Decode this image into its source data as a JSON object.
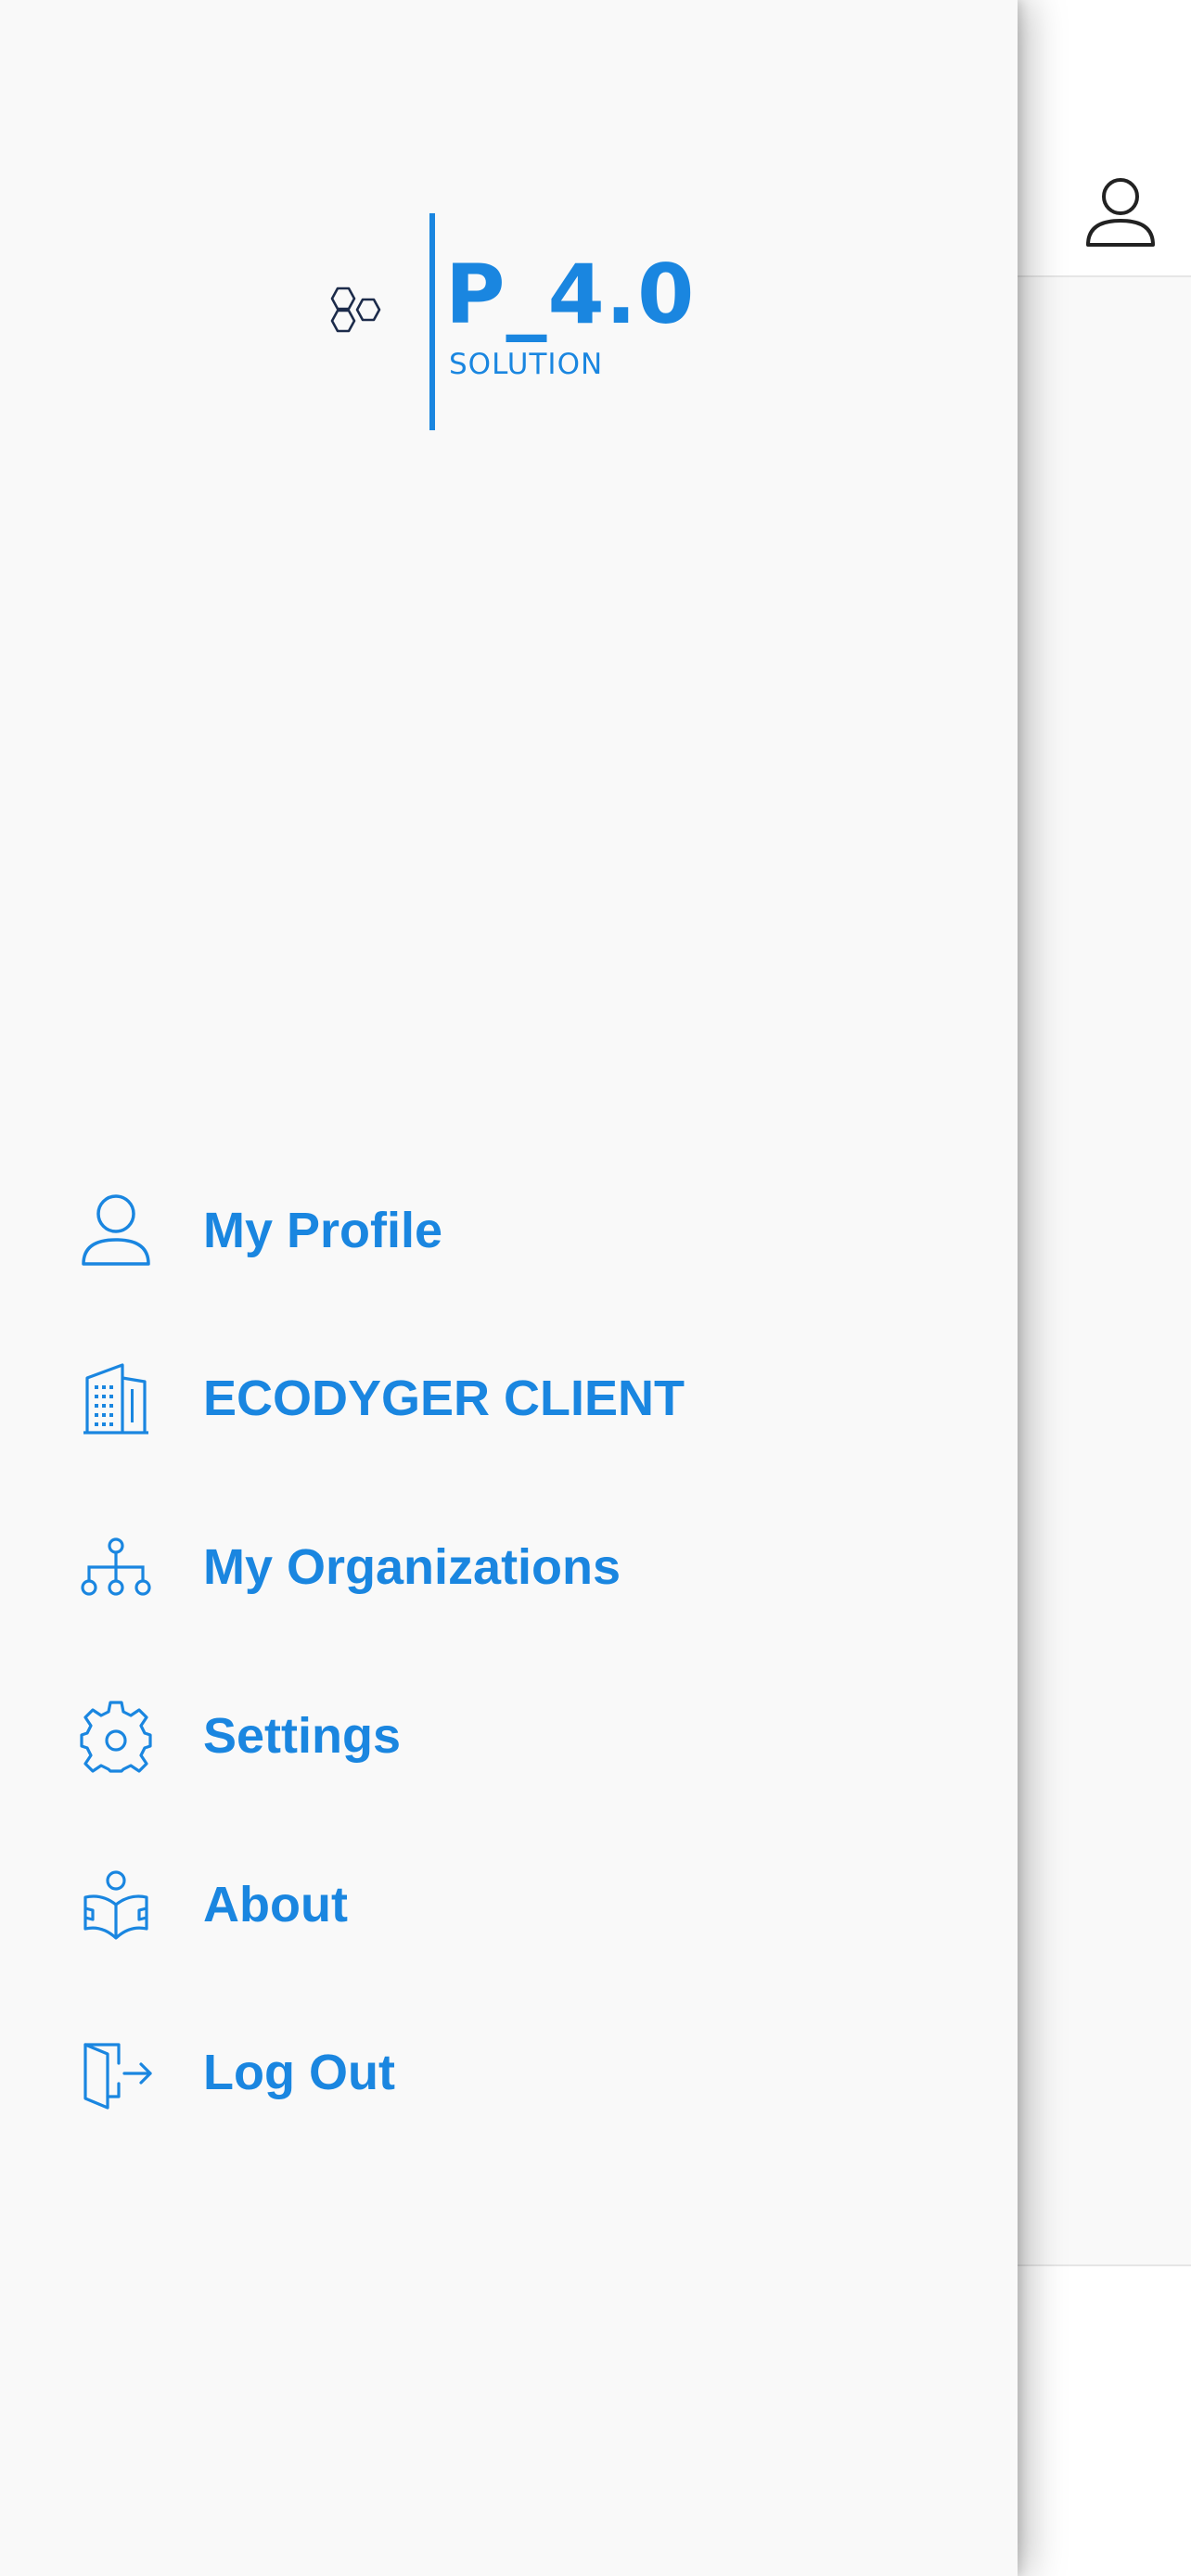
{
  "colors": {
    "accent": "#1a86e0",
    "drawer_background": "#f9f9f9",
    "logo_hex_stroke": "#1c2b4a",
    "underlay_icon": "#222222"
  },
  "logo": {
    "title": "P_4.0",
    "subtitle": "SOLUTION",
    "mark_icon": "hexagon-cluster-icon"
  },
  "menu": {
    "items": [
      {
        "label": "My Profile",
        "icon": "user-icon"
      },
      {
        "label": "ECODYGER CLIENT",
        "icon": "building-icon"
      },
      {
        "label": "My Organizations",
        "icon": "org-chart-icon"
      },
      {
        "label": "Settings",
        "icon": "gear-icon"
      },
      {
        "label": "About",
        "icon": "reader-book-icon"
      },
      {
        "label": "Log Out",
        "icon": "door-exit-icon"
      }
    ]
  },
  "underlay": {
    "header_icon": "user-icon"
  }
}
